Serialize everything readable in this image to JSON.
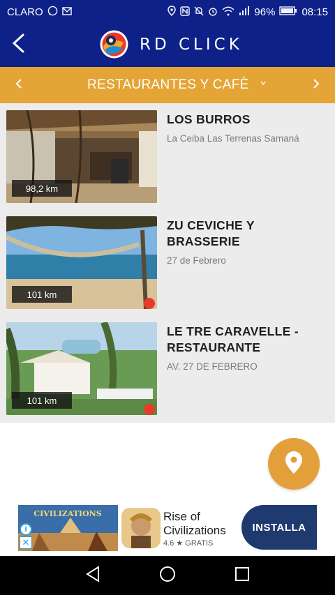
{
  "status_bar": {
    "carrier": "CLARO",
    "battery": "96%",
    "time": "08:15"
  },
  "header": {
    "title": "RD CLICK"
  },
  "category": {
    "title": "RESTAURANTES Y CAFÈ"
  },
  "places": [
    {
      "name": "LOS BURROS",
      "address": "La Ceiba Las Terrenas Samaná",
      "distance": "98,2 km"
    },
    {
      "name": "ZU CEVICHE Y BRASSERIE",
      "address": "27 de Febrero",
      "distance": "101 km"
    },
    {
      "name": "LE TRE CARAVELLE - RESTAURANTE",
      "address": "AV.  27 DE FEBRERO",
      "distance": "101 km"
    }
  ],
  "ad": {
    "banner_text": "CIVILIZATIONS",
    "app_name": "Rise of Civilizations",
    "rating": "4.6 ★ GRATIS",
    "install_label": "INSTALLA"
  },
  "colors": {
    "primary": "#0d2189",
    "accent": "#e4a436"
  }
}
